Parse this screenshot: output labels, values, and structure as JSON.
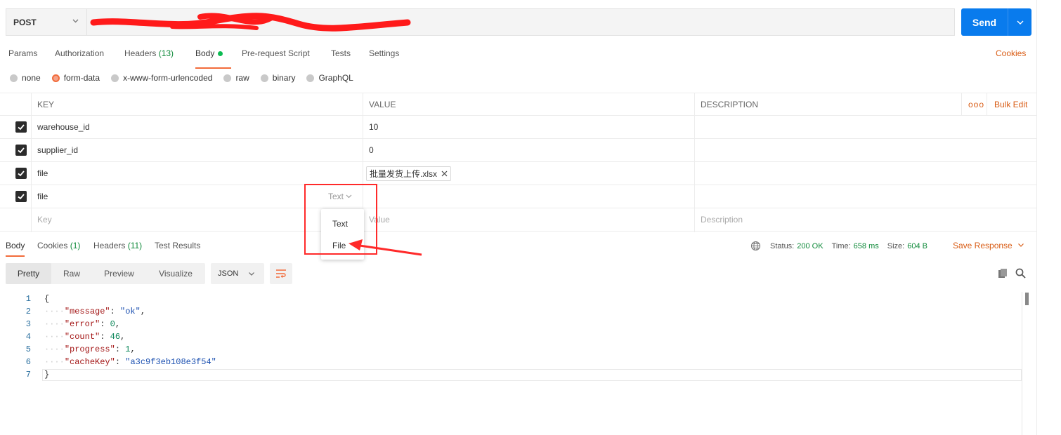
{
  "request": {
    "method": "POST",
    "send_label": "Send"
  },
  "tabs": [
    {
      "label": "Params"
    },
    {
      "label": "Authorization"
    },
    {
      "label": "Headers",
      "count": "(13)"
    },
    {
      "label": "Body"
    },
    {
      "label": "Pre-request Script"
    },
    {
      "label": "Tests"
    },
    {
      "label": "Settings"
    }
  ],
  "cookies_label": "Cookies",
  "body_types": [
    {
      "label": "none",
      "selected": false
    },
    {
      "label": "form-data",
      "selected": true
    },
    {
      "label": "x-www-form-urlencoded",
      "selected": false
    },
    {
      "label": "raw",
      "selected": false
    },
    {
      "label": "binary",
      "selected": false
    },
    {
      "label": "GraphQL",
      "selected": false
    }
  ],
  "table": {
    "headers": {
      "key": "KEY",
      "value": "VALUE",
      "description": "DESCRIPTION",
      "more": "ooo",
      "bulk_edit": "Bulk Edit"
    },
    "rows": [
      {
        "key": "warehouse_id",
        "value": "10"
      },
      {
        "key": "supplier_id",
        "value": "0"
      },
      {
        "key": "file",
        "value": "批量发货上传.xlsx"
      },
      {
        "key": "file",
        "value": ""
      }
    ],
    "placeholders": {
      "key": "Key",
      "value": "Value",
      "description": "Description"
    }
  },
  "type_selector": {
    "current": "Text",
    "options": [
      "Text",
      "File"
    ]
  },
  "response": {
    "tabs": [
      {
        "label": "Body"
      },
      {
        "label": "Cookies",
        "count": "(1)"
      },
      {
        "label": "Headers",
        "count": "(11)"
      },
      {
        "label": "Test Results"
      }
    ],
    "status_label": "Status:",
    "status_value": "200 OK",
    "time_label": "Time:",
    "time_value": "658 ms",
    "size_label": "Size:",
    "size_value": "604 B",
    "save_label": "Save Response",
    "view_modes": [
      "Pretty",
      "Raw",
      "Preview",
      "Visualize"
    ],
    "format": "JSON",
    "json_lines": [
      {
        "n": "1"
      },
      {
        "n": "2"
      },
      {
        "n": "3"
      },
      {
        "n": "4"
      },
      {
        "n": "5"
      },
      {
        "n": "6"
      },
      {
        "n": "7"
      }
    ],
    "json": {
      "message": "ok",
      "error": "0",
      "count": "46",
      "progress": "1",
      "cacheKey": "a3c9f3eb108e3f54"
    }
  },
  "colors": {
    "accent": "#f26b3a",
    "send": "#097bed",
    "status_ok": "#0f8a3a",
    "annotation": "#ff2a2a"
  }
}
